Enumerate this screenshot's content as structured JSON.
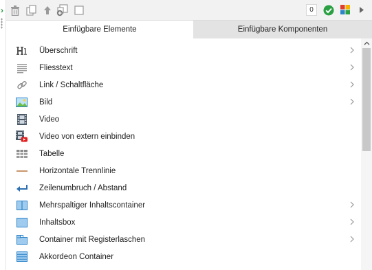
{
  "toolbar": {
    "icons": [
      "trash-icon",
      "copy-icon",
      "move-up-icon",
      "insert-component-icon",
      "checkbox-icon"
    ],
    "counter": "0",
    "status_icon": "check-circle-icon",
    "palette_icon": "color-grid-icon",
    "more_icon": "caret-right-icon"
  },
  "tabs": {
    "elements": "Einfügbare Elemente",
    "components": "Einfügbare Komponenten"
  },
  "items": [
    {
      "label": "Überschrift",
      "icon": "heading-icon",
      "has_submenu": true
    },
    {
      "label": "Fliesstext",
      "icon": "paragraph-icon",
      "has_submenu": true
    },
    {
      "label": "Link / Schaltfläche",
      "icon": "link-icon",
      "has_submenu": true
    },
    {
      "label": "Bild",
      "icon": "image-icon",
      "has_submenu": true
    },
    {
      "label": "Video",
      "icon": "film-icon",
      "has_submenu": false
    },
    {
      "label": "Video von extern einbinden",
      "icon": "youtube-film-icon",
      "has_submenu": false
    },
    {
      "label": "Tabelle",
      "icon": "table-icon",
      "has_submenu": false
    },
    {
      "label": "Horizontale Trennlinie",
      "icon": "horizontal-rule-icon",
      "has_submenu": false
    },
    {
      "label": "Zeilenumbruch / Abstand",
      "icon": "line-break-icon",
      "has_submenu": false
    },
    {
      "label": "Mehrspaltiger Inhaltscontainer",
      "icon": "columns-icon",
      "has_submenu": true
    },
    {
      "label": "Inhaltsbox",
      "icon": "box-icon",
      "has_submenu": true
    },
    {
      "label": "Container mit Registerlaschen",
      "icon": "tabs-container-icon",
      "has_submenu": true
    },
    {
      "label": "Akkordeon Container",
      "icon": "accordion-icon",
      "has_submenu": false
    }
  ],
  "colors": {
    "accent_green": "#2aa043",
    "icon_blue": "#2c83c8",
    "icon_gray": "#9a9a9a"
  }
}
